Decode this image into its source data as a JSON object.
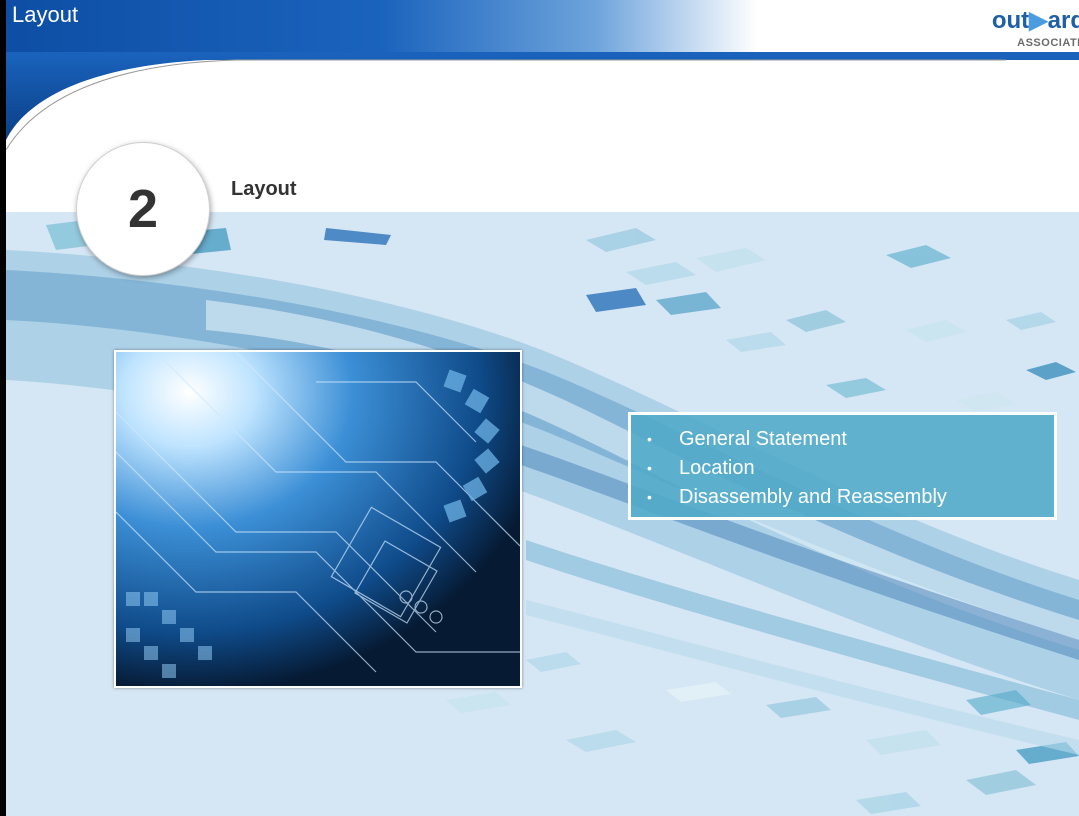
{
  "header": {
    "title": "Layout",
    "logo_text_start": "out",
    "logo_text_end": "ard",
    "logo_subtext": "ASSOCIATE",
    "colors": {
      "banner": "#1a5fb0",
      "logo_blue": "#1f5fa8",
      "logo_accent": "#4a9be0"
    }
  },
  "section": {
    "number": "2",
    "title": "Layout"
  },
  "content": {
    "bullet_symbol": "•",
    "bullets": [
      {
        "label": "General Statement"
      },
      {
        "label": "Location"
      },
      {
        "label": "Disassembly and Reassembly"
      }
    ],
    "box_color": "#50aac8"
  },
  "image": {
    "icon": "technology-circuit-image"
  }
}
